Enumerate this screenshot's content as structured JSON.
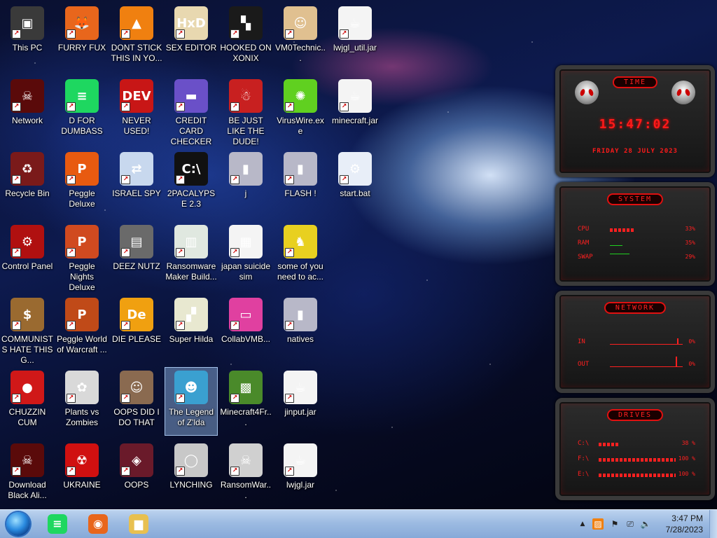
{
  "desktop": {
    "icons": [
      {
        "label": "This PC",
        "icon": "computer-icon",
        "color": "#3a3a3a",
        "glyph": "▣"
      },
      {
        "label": "Network",
        "icon": "alien-skull-icon",
        "color": "#5a0a0a",
        "glyph": "☠"
      },
      {
        "label": "Recycle Bin",
        "icon": "recycle-bin-icon",
        "color": "#7a1a1a",
        "glyph": "♻"
      },
      {
        "label": "Control Panel",
        "icon": "control-panel-icon",
        "color": "#b01010",
        "glyph": "⚙"
      },
      {
        "label": "COMMUNISTS HATE THIS G...",
        "icon": "money-bag-icon",
        "color": "#9a6a30",
        "glyph": "$"
      },
      {
        "label": "CHUZZIN CUM",
        "icon": "chuzzle-icon",
        "color": "#d01818",
        "glyph": "●"
      },
      {
        "label": "Download Black Ali...",
        "icon": "alien-skull-icon",
        "color": "#5a0a0a",
        "glyph": "☠"
      },
      {
        "label": "FURRY FUX",
        "icon": "firefox-icon",
        "color": "#e8661c",
        "glyph": "🦊"
      },
      {
        "label": "D FOR DUMBASS",
        "icon": "spotify-like-icon",
        "color": "#1ed760",
        "glyph": "≡"
      },
      {
        "label": "Peggle Deluxe",
        "icon": "peggle-icon",
        "color": "#e85a10",
        "glyph": "P"
      },
      {
        "label": "Peggle Nights Deluxe",
        "icon": "peggle-icon",
        "color": "#d04a20",
        "glyph": "P"
      },
      {
        "label": "Peggle World of Warcraft ...",
        "icon": "peggle-icon",
        "color": "#c04a18",
        "glyph": "P"
      },
      {
        "label": "Plants vs Zombies",
        "icon": "flower-icon",
        "color": "#d9d9d9",
        "glyph": "✿"
      },
      {
        "label": "UKRAINE",
        "icon": "radiation-icon",
        "color": "#d01010",
        "glyph": "☢"
      },
      {
        "label": "DONT STICK THIS IN YO...",
        "icon": "vlc-cone-icon",
        "color": "#f08010",
        "glyph": "▲"
      },
      {
        "label": "NEVER USED!",
        "icon": "dev-cpp-icon",
        "color": "#c81616",
        "glyph": "DEV"
      },
      {
        "label": "ISRAEL SPY",
        "icon": "network-spy-icon",
        "color": "#c8d8ee",
        "glyph": "⇄"
      },
      {
        "label": "DEEZ NUTZ",
        "icon": "window-stack-icon",
        "color": "#6a6a6a",
        "glyph": "▤"
      },
      {
        "label": "DIE PLEASE",
        "icon": "de-icon",
        "color": "#f0a010",
        "glyph": "De"
      },
      {
        "label": "OOPS DID I DO THAT",
        "icon": "portrait-icon",
        "color": "#8a6a50",
        "glyph": "☺"
      },
      {
        "label": "OOPS",
        "icon": "oops-icon",
        "color": "#6a1a2a",
        "glyph": "◈"
      },
      {
        "label": "SEX EDITOR",
        "icon": "hxd-icon",
        "color": "#e8d8b0",
        "glyph": "HxD"
      },
      {
        "label": "CREDIT CARD CHECKER",
        "icon": "credit-card-icon",
        "color": "#6a50c8",
        "glyph": "▬"
      },
      {
        "label": "2PACALYPSE 2.3",
        "icon": "console-icon",
        "color": "#111111",
        "glyph": "C:\\"
      },
      {
        "label": "Ransomware Maker Build...",
        "icon": "window-app-icon",
        "color": "#e0e8e0",
        "glyph": "▥"
      },
      {
        "label": "Super Hilda",
        "icon": "pixel-game-icon",
        "color": "#e8e8d0",
        "glyph": "▞"
      },
      {
        "label": "The Legend of Z'lda",
        "icon": "pixel-hero-icon",
        "color": "#3aa0d0",
        "glyph": "☻"
      },
      {
        "label": "LYNCHING",
        "icon": "rope-icon",
        "color": "#c8c8c8",
        "glyph": "◯"
      },
      {
        "label": "HOOKED ON XONIX",
        "icon": "xonix-icon",
        "color": "#1a1a1a",
        "glyph": "▚"
      },
      {
        "label": "BE JUST LIKE THE DUDE!",
        "icon": "santa-icon",
        "color": "#c82020",
        "glyph": "☃"
      },
      {
        "label": "j",
        "icon": "folder-dark-icon",
        "color": "#b8b8c8",
        "glyph": "▮"
      },
      {
        "label": "japan suicide sim",
        "icon": "document-icon",
        "color": "#f4f4f4",
        "glyph": "▦"
      },
      {
        "label": "CollabVMB...",
        "icon": "monitor-pink-icon",
        "color": "#e040a0",
        "glyph": "▭"
      },
      {
        "label": "Minecraft4Fr...",
        "icon": "grass-block-icon",
        "color": "#4a8a2a",
        "glyph": "▩"
      },
      {
        "label": "RansomWar...",
        "icon": "skull-chain-icon",
        "color": "#d0d0d0",
        "glyph": "☠"
      },
      {
        "label": "VM0Technic...",
        "icon": "doctor-icon",
        "color": "#e0c090",
        "glyph": "☺"
      },
      {
        "label": "VirusWire.exe",
        "icon": "lime-icon",
        "color": "#60d020",
        "glyph": "✺"
      },
      {
        "label": "FLASH !",
        "icon": "folder-dark-icon",
        "color": "#b8b8c8",
        "glyph": "▮"
      },
      {
        "label": "some of you need to ac...",
        "icon": "scooby-icon",
        "color": "#e8d020",
        "glyph": "♞"
      },
      {
        "label": "natives",
        "icon": "folder-dark-icon",
        "color": "#b8b8c8",
        "glyph": "▮"
      },
      {
        "label": "jinput.jar",
        "icon": "java-icon",
        "color": "#f4f4f4",
        "glyph": "☕"
      },
      {
        "label": "lwjgl.jar",
        "icon": "java-icon",
        "color": "#f4f4f4",
        "glyph": "☕"
      },
      {
        "label": "lwjgl_util.jar",
        "icon": "java-icon",
        "color": "#f4f4f4",
        "glyph": "☕"
      },
      {
        "label": "minecraft.jar",
        "icon": "java-icon",
        "color": "#f4f4f4",
        "glyph": "☕"
      },
      {
        "label": "start.bat",
        "icon": "batch-gear-icon",
        "color": "#e8eef8",
        "glyph": "⚙"
      }
    ]
  },
  "widgets": {
    "time": {
      "title": "TIME",
      "time": "15:47:02",
      "date": "FRIDAY 28 JULY 2023"
    },
    "system": {
      "title": "SYSTEM",
      "rows": [
        {
          "label": "CPU",
          "value": "33%"
        },
        {
          "label": "RAM",
          "value": "35%"
        },
        {
          "label": "SWAP",
          "value": "29%"
        }
      ]
    },
    "network": {
      "title": "NETWORK",
      "rows": [
        {
          "label": "IN",
          "value": "0%"
        },
        {
          "label": "OUT",
          "value": "0%"
        }
      ]
    },
    "drives": {
      "title": "DRIVES",
      "rows": [
        {
          "label": "C:\\",
          "value": "38 %"
        },
        {
          "label": "F:\\",
          "value": "100 %"
        },
        {
          "label": "E:\\",
          "value": "100 %"
        }
      ]
    }
  },
  "taskbar": {
    "pinned": [
      {
        "name": "notes-app-icon",
        "color": "#1ed760",
        "glyph": "≡"
      },
      {
        "name": "firefox-icon",
        "color": "#e8661c",
        "glyph": "◉"
      },
      {
        "name": "file-explorer-icon",
        "color": "#e8c050",
        "glyph": "▆"
      }
    ],
    "tray": {
      "chevron": "▲",
      "time": "3:47 PM",
      "date": "7/28/2023"
    }
  }
}
